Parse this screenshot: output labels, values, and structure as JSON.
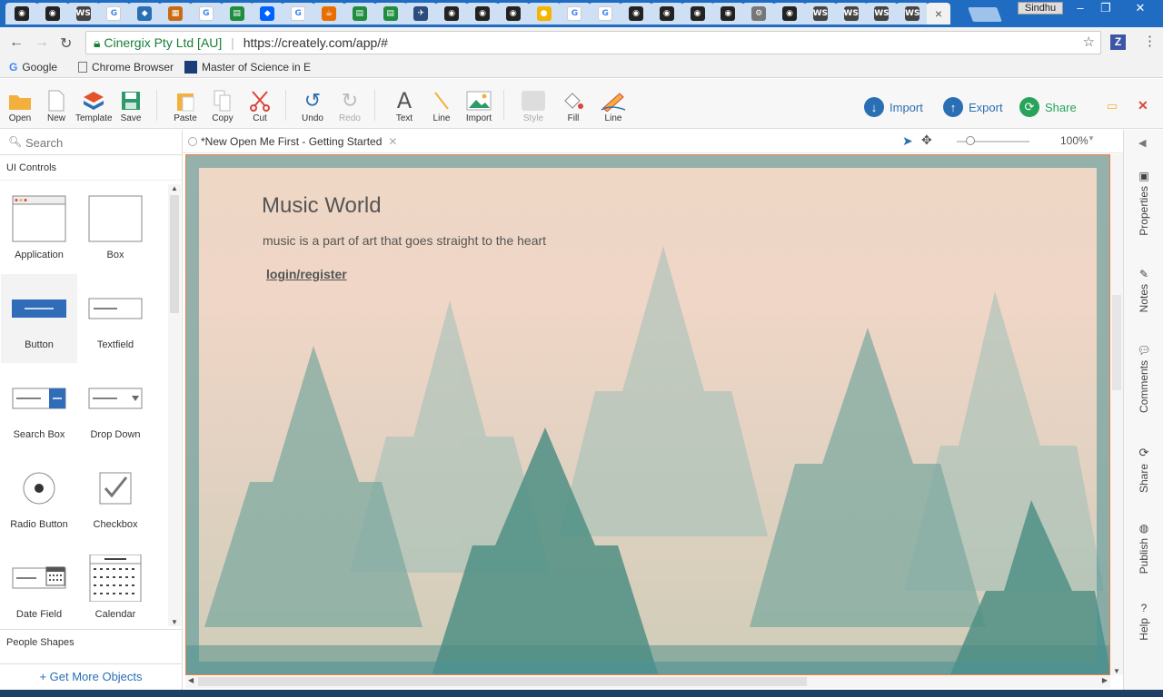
{
  "browser": {
    "user_badge": "Sindhu",
    "address": {
      "secure_label": "Cinergix Pty Ltd [AU]",
      "url": "https://creately.com/app/#"
    },
    "bookmarks": [
      {
        "label": "Google"
      },
      {
        "label": "Chrome Browser"
      },
      {
        "label": "Master of Science in E"
      }
    ],
    "tab_favicons": [
      "github",
      "github",
      "ws",
      "google",
      "ext",
      "archive",
      "google",
      "sheets",
      "dropbox",
      "google",
      "java",
      "sheets",
      "sheets",
      "ext2",
      "github",
      "github",
      "github",
      "pin",
      "google",
      "google",
      "github",
      "github",
      "github",
      "github",
      "gear",
      "github",
      "ws",
      "ws",
      "ws",
      "ws"
    ],
    "active_tab_close": "×"
  },
  "toolbar": {
    "groups": [
      {
        "items": [
          {
            "label": "Open",
            "icon": "folder-icon"
          },
          {
            "label": "New",
            "icon": "new-doc-icon"
          },
          {
            "label": "Template",
            "icon": "template-icon"
          },
          {
            "label": "Save",
            "icon": "save-icon"
          }
        ]
      },
      {
        "items": [
          {
            "label": "Paste",
            "icon": "paste-icon"
          },
          {
            "label": "Copy",
            "icon": "copy-icon"
          },
          {
            "label": "Cut",
            "icon": "scissors-icon"
          }
        ]
      },
      {
        "items": [
          {
            "label": "Undo",
            "icon": "undo-icon"
          },
          {
            "label": "Redo",
            "icon": "redo-icon"
          }
        ]
      },
      {
        "items": [
          {
            "label": "Text",
            "icon": "text-icon"
          },
          {
            "label": "Line",
            "icon": "line-icon"
          },
          {
            "label": "Import",
            "icon": "image-icon"
          }
        ]
      },
      {
        "items": [
          {
            "label": "Style",
            "icon": "style-icon"
          },
          {
            "label": "Fill",
            "icon": "fill-icon"
          },
          {
            "label": "Line",
            "icon": "pen-icon"
          }
        ]
      }
    ],
    "actions": {
      "import": "Import",
      "export": "Export",
      "share": "Share"
    }
  },
  "left_panel": {
    "search_placeholder": "Search",
    "section": "UI Controls",
    "shapes": [
      {
        "label": "Application"
      },
      {
        "label": "Box"
      },
      {
        "label": "Button"
      },
      {
        "label": "Textfield"
      },
      {
        "label": "Search Box"
      },
      {
        "label": "Drop Down"
      },
      {
        "label": "Radio Button"
      },
      {
        "label": "Checkbox"
      },
      {
        "label": "Date Field"
      },
      {
        "label": "Calendar"
      }
    ],
    "bottom_section": "People Shapes",
    "more_objects": "+ Get More Objects"
  },
  "document": {
    "tab_title": "*New Open Me First - Getting Started",
    "zoom": "100%"
  },
  "canvas": {
    "heading": "Music World",
    "subtitle": "music is a part of art that goes straight to the heart",
    "link": "login/register"
  },
  "right_rail": [
    "Properties",
    "Notes",
    "Comments",
    "Share",
    "Publish",
    "Help"
  ],
  "colors": {
    "chrome_blue": "#1f6cc2",
    "accent_blue": "#2a6fb3",
    "share_green": "#27a35a",
    "canvas_border": "#f08040"
  }
}
